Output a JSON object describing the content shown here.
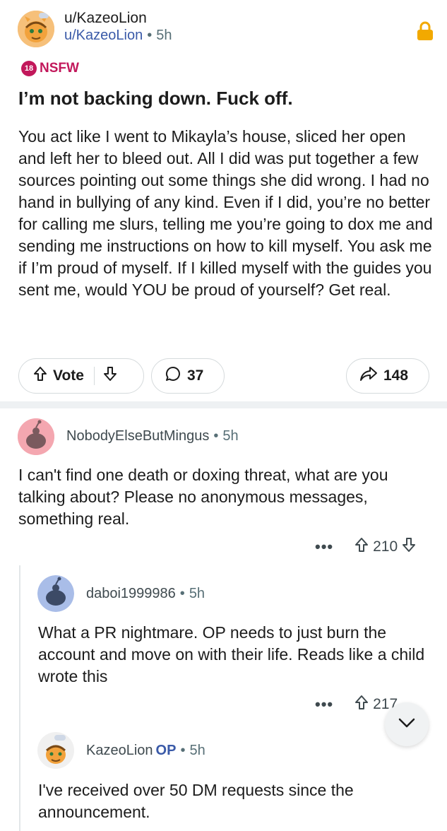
{
  "post": {
    "username": "u/KazeoLion",
    "sub_user": "u/KazeoLion",
    "age": "5h",
    "nsfw_badge": "18",
    "nsfw_label": "NSFW",
    "title": "I’m not backing down. Fuck off.",
    "body": "You act like I went to Mikayla’s house, sliced her open and left her to bleed out. All I did was put together a few sources pointing out some things she did wrong. I had no hand in bullying of any kind. Even if I did, you’re no better for calling me slurs, telling me you’re going to dox me and sending me instructions on how to kill myself. You ask me if I’m proud of myself. If I killed myself with the guides you sent me, would YOU be proud of yourself? Get real.",
    "vote_label": "Vote",
    "comment_count": "37",
    "share_count": "148",
    "colors": {
      "nsfw": "#c2185b",
      "link": "#3a5aa8",
      "lock": "#f2a900"
    }
  },
  "comments": [
    {
      "username": "NobodyElseButMingus",
      "age": "5h",
      "body": "I can't find one death or doxing threat, what are you talking about? Please no anonymous messages, something real.",
      "more": "•••",
      "votes": "210"
    },
    {
      "username": "daboi1999986",
      "age": "5h",
      "body": "What a PR nightmare. OP needs to just burn the account and move on with their life. Reads like a child wrote this",
      "more": "•••",
      "votes": "217"
    },
    {
      "username": "KazeoLion",
      "op_label": "OP",
      "age": "5h",
      "body": "I've received over 50 DM requests since the announcement."
    }
  ],
  "icons": [
    "lock-icon",
    "upvote-icon",
    "downvote-icon",
    "comment-icon",
    "share-icon",
    "chevron-down-icon"
  ]
}
